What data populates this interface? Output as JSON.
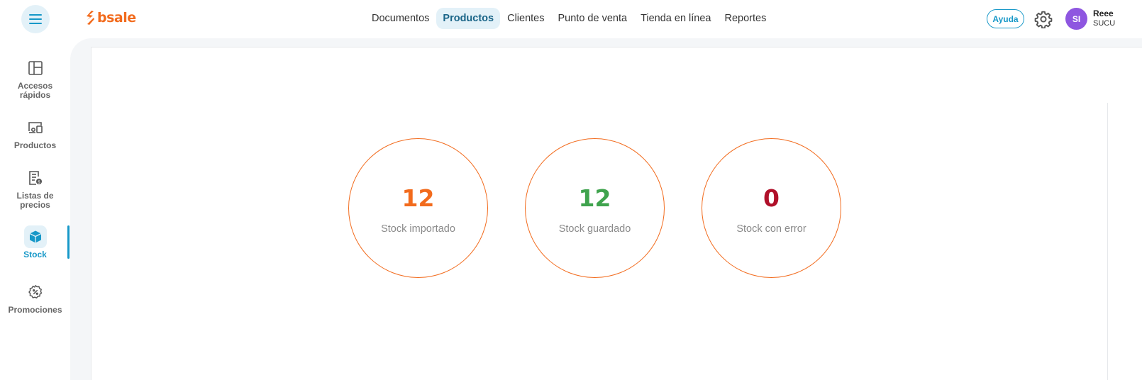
{
  "header": {
    "logo_text": "bsale",
    "nav": [
      {
        "label": "Documentos"
      },
      {
        "label": "Productos"
      },
      {
        "label": "Clientes"
      },
      {
        "label": "Punto de venta"
      },
      {
        "label": "Tienda en línea"
      },
      {
        "label": "Reportes"
      }
    ],
    "active_nav": "Productos",
    "help_label": "Ayuda",
    "avatar_initials": "SI",
    "user_name": "Reee",
    "user_sub": "SUCU"
  },
  "sidebar": {
    "items": [
      {
        "label": "Accesos rápidos",
        "icon": "layout-icon"
      },
      {
        "label": "Productos",
        "icon": "devices-icon"
      },
      {
        "label": "Listas de precios",
        "icon": "price-list-icon"
      },
      {
        "label": "Stock",
        "icon": "box-icon"
      },
      {
        "label": "Promociones",
        "icon": "discount-badge-icon"
      }
    ],
    "active": "Stock"
  },
  "stats": [
    {
      "value": "12",
      "label": "Stock importado",
      "color": "#f26b1d"
    },
    {
      "value": "12",
      "label": "Stock guardado",
      "color": "#3fa34d"
    },
    {
      "value": "0",
      "label": "Stock con error",
      "color": "#b0102a"
    }
  ],
  "colors": {
    "brand": "#f26b1d",
    "accent": "#1798c8",
    "avatar": "#8e56e0"
  }
}
